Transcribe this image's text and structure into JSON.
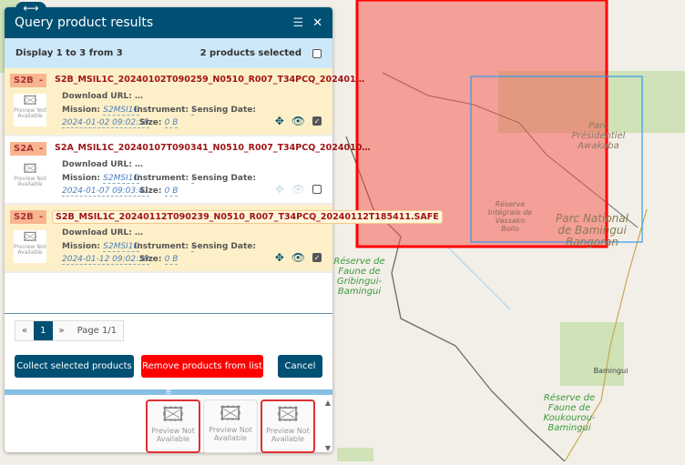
{
  "map": {
    "labels": [
      "Parc Présidentiel Awakaba",
      "Réserve Intégrale de Vassako Bollo",
      "Parc National de Bamingui Bangoran",
      "Réserve de Faune de Gribingui-Bamingui",
      "Bamingui",
      "Réserve de Faune de Koukourou-Bamingui"
    ],
    "footprint_selected_color": "#ff0000",
    "footprint_hover_color": "#3399ee"
  },
  "panel": {
    "title": "Query product results",
    "summary": "Display 1 to 3 from 3",
    "selected_count": "2 products selected",
    "products": [
      {
        "platform": "S2B",
        "flag": "-",
        "name": "S2B_MSIL1C_20240102T090259_N0510_R007_T34PCQ_202401…",
        "download_label": "Download URL:",
        "download_value": "…",
        "mission_label": "Mission:",
        "mission": "S2MSI1C",
        "instrument_label": "Instrument:",
        "instrument": "-",
        "sensing_label": "Sensing Date:",
        "date": "2024-01-02 09:02:59",
        "size_label": "Size:",
        "size": "0 B",
        "selected": true,
        "preview": "Preview Not Available"
      },
      {
        "platform": "S2A",
        "flag": "-",
        "name": "S2A_MSIL1C_20240107T090341_N0510_R007_T34PCQ_2024010…",
        "download_label": "Download URL:",
        "download_value": "…",
        "mission_label": "Mission:",
        "mission": "S2MSI1C",
        "instrument_label": "Instrument:",
        "instrument": "-",
        "sensing_label": "Sensing Date:",
        "date": "2024-01-07 09:03:41",
        "size_label": "Size:",
        "size": "0 B",
        "selected": false,
        "preview": "Preview Not Available"
      },
      {
        "platform": "S2B",
        "flag": "-",
        "name": "S2B_MSIL1C_20240112T090239_N0510_R007_T34PCQ_20240112T185411.SAFE",
        "download_label": "Download URL:",
        "download_value": "…",
        "mission_label": "Mission:",
        "mission": "S2MSI1C",
        "instrument_label": "Instrument:",
        "instrument": "-",
        "sensing_label": "Sensing Date:",
        "date": "2024-01-12 09:02:39",
        "size_label": "Size:",
        "size": "0 B",
        "selected": true,
        "preview": "Preview Not Available"
      }
    ],
    "pager": {
      "prev": "«",
      "page": "1",
      "next": "»",
      "info": "Page 1/1"
    },
    "buttons": {
      "collect": "Collect selected products",
      "remove": "Remove products from list",
      "cancel": "Cancel"
    },
    "colors": {
      "header": "#005073",
      "remove": "#ff0000",
      "selected_row": "#fdf0c8"
    }
  }
}
